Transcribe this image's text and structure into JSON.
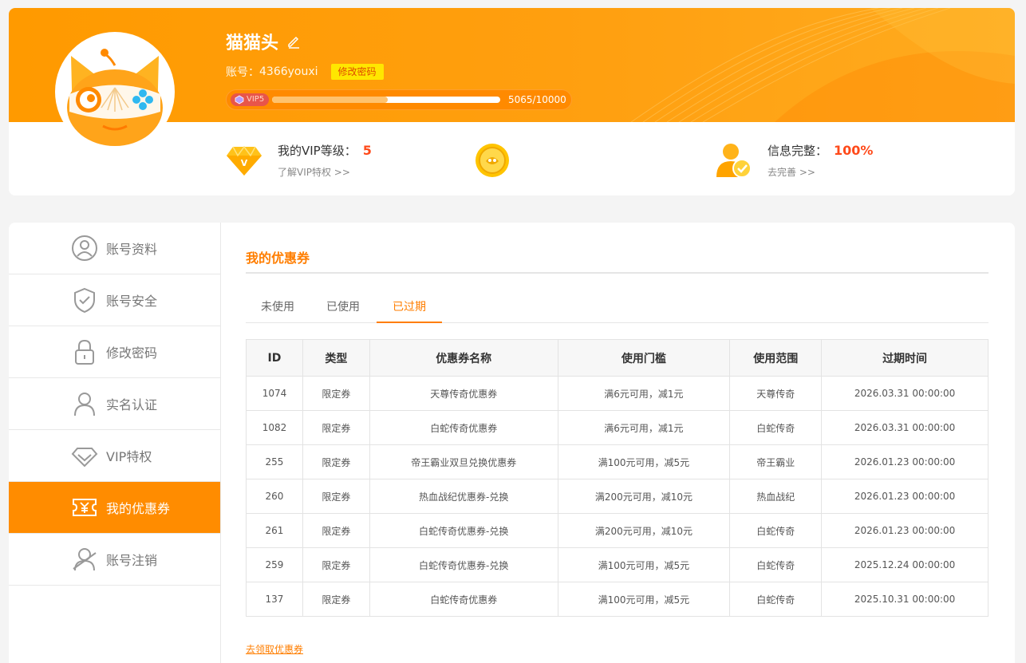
{
  "profile": {
    "username": "猫猫头",
    "account_label": "账号：",
    "account_id": "4366youxi",
    "change_password": "修改密码",
    "vip_badge": "VIP5",
    "exp_current": 5065,
    "exp_max": 10000,
    "exp_text": "5065/10000"
  },
  "stats": {
    "vip_label": "我的VIP等级：",
    "vip_value": "5",
    "vip_link": "了解VIP特权 >>",
    "info_label": "信息完整：",
    "info_value": "100%",
    "info_link": "去完善 >>"
  },
  "sidebar": {
    "items": [
      {
        "label": "账号资料",
        "icon": "user-circle-icon"
      },
      {
        "label": "账号安全",
        "icon": "shield-check-icon"
      },
      {
        "label": "修改密码",
        "icon": "lock-icon"
      },
      {
        "label": "实名认证",
        "icon": "person-icon"
      },
      {
        "label": "VIP特权",
        "icon": "diamond-icon"
      },
      {
        "label": "我的优惠券",
        "icon": "coupon-icon",
        "active": true
      },
      {
        "label": "账号注销",
        "icon": "user-cancel-icon"
      }
    ]
  },
  "main": {
    "title": "我的优惠券",
    "tabs": [
      "未使用",
      "已使用",
      "已过期"
    ],
    "active_tab": "已过期",
    "table": {
      "headers": [
        "ID",
        "类型",
        "优惠券名称",
        "使用门槛",
        "使用范围",
        "过期时间"
      ],
      "rows": [
        [
          "1074",
          "限定券",
          "天尊传奇优惠券",
          "满6元可用，减1元",
          "天尊传奇",
          "2026.03.31 00:00:00"
        ],
        [
          "1082",
          "限定券",
          "白蛇传奇优惠券",
          "满6元可用，减1元",
          "白蛇传奇",
          "2026.03.31 00:00:00"
        ],
        [
          "255",
          "限定券",
          "帝王霸业双旦兑换优惠券",
          "满100元可用，减5元",
          "帝王霸业",
          "2026.01.23 00:00:00"
        ],
        [
          "260",
          "限定券",
          "热血战纪优惠券-兑换",
          "满200元可用，减10元",
          "热血战纪",
          "2026.01.23 00:00:00"
        ],
        [
          "261",
          "限定券",
          "白蛇传奇优惠券-兑换",
          "满200元可用，减10元",
          "白蛇传奇",
          "2026.01.23 00:00:00"
        ],
        [
          "259",
          "限定券",
          "白蛇传奇优惠券-兑换",
          "满100元可用，减5元",
          "白蛇传奇",
          "2025.12.24 00:00:00"
        ],
        [
          "137",
          "限定券",
          "白蛇传奇优惠券",
          "满100元可用，减5元",
          "白蛇传奇",
          "2025.10.31 00:00:00"
        ]
      ]
    },
    "get_coupon_link": "去领取优惠券"
  },
  "colors": {
    "accent": "#ff8c00",
    "highlight": "#ff4a1a",
    "badge": "#ffe600"
  }
}
